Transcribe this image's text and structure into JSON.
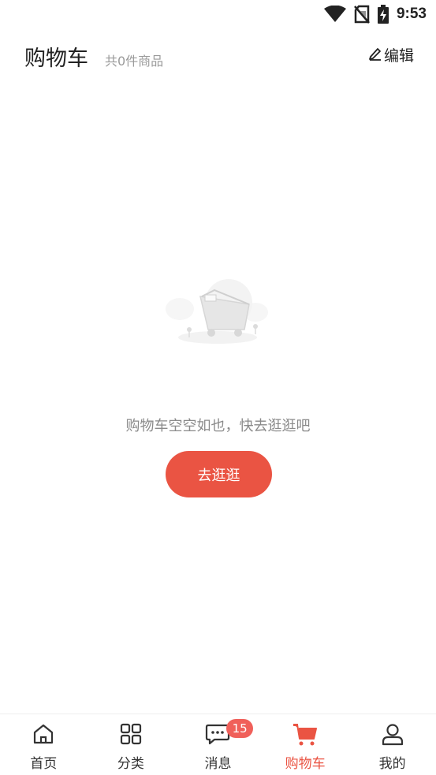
{
  "status_bar": {
    "time": "9:53",
    "icons": [
      "wifi-icon",
      "no-sim-icon",
      "battery-charging-icon"
    ]
  },
  "header": {
    "title": "购物车",
    "item_count": "共0件商品",
    "edit_label": "编辑",
    "edit_icon": "pencil-icon"
  },
  "empty_state": {
    "illustration": "empty-cart-illustration",
    "message": "购物车空空如也，快去逛逛吧",
    "button_label": "去逛逛"
  },
  "bottom_nav": {
    "active": "购物车",
    "items": [
      {
        "label": "首页",
        "icon": "home-icon"
      },
      {
        "label": "分类",
        "icon": "grid-icon"
      },
      {
        "label": "消息",
        "icon": "message-icon",
        "badge": "15"
      },
      {
        "label": "购物车",
        "icon": "cart-icon"
      },
      {
        "label": "我的",
        "icon": "user-icon"
      }
    ]
  },
  "colors": {
    "accent": "#ea5443",
    "badge": "#f0605a",
    "text_primary": "#222222",
    "text_secondary": "#8a8a8a"
  }
}
